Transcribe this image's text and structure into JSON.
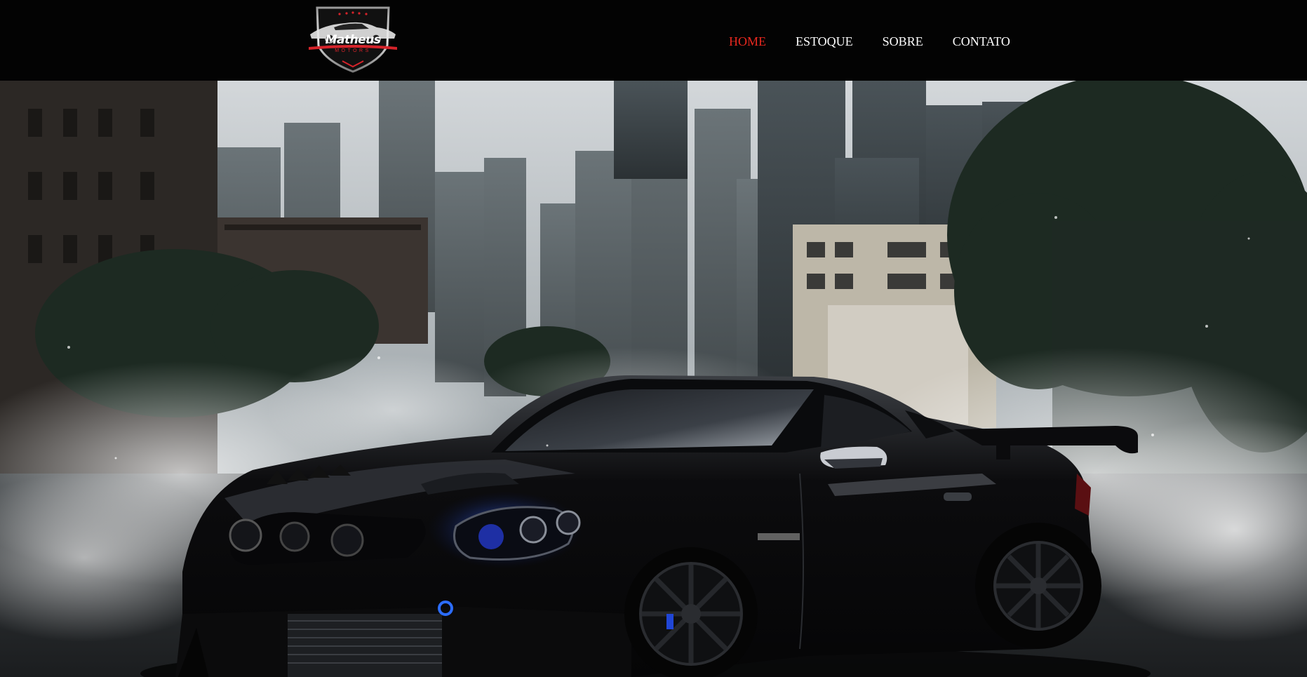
{
  "brand": {
    "name": "Matheus",
    "sub": "MOTORS"
  },
  "nav": {
    "items": [
      {
        "label": "HOME",
        "active": true
      },
      {
        "label": "ESTOQUE",
        "active": false
      },
      {
        "label": "SOBRE",
        "active": false
      },
      {
        "label": "CONTATO",
        "active": false
      }
    ]
  },
  "colors": {
    "header_bg": "#030303",
    "nav_active": "#e8281f",
    "nav_text": "#ffffff",
    "logo_accent": "#d6232a"
  },
  "hero": {
    "image": "black-tuned-sports-car-city-skyline-smoke"
  }
}
